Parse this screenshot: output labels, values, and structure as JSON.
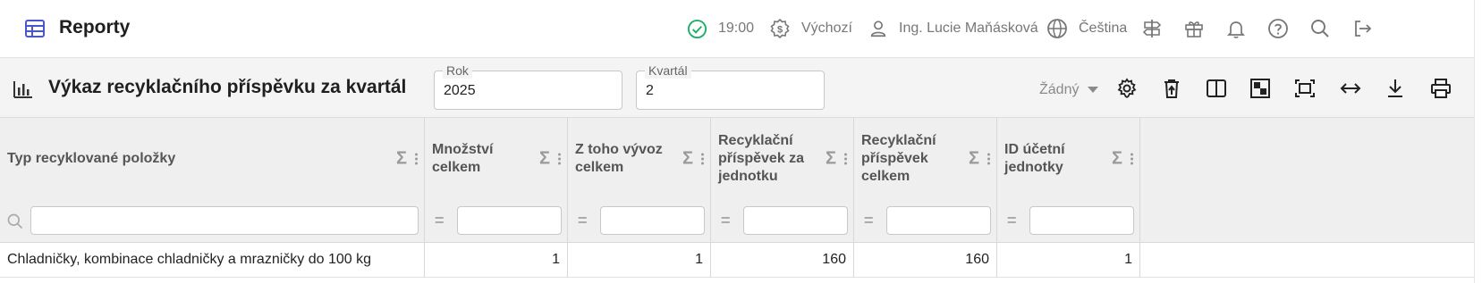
{
  "app": {
    "title": "Reporty",
    "icon": "table-icon"
  },
  "topbar": {
    "time": "19:00",
    "currency": "Výchozí",
    "user": "Ing. Lucie Maňásková",
    "language": "Čeština",
    "icons": [
      "check-circle-icon",
      "currency-icon",
      "user-icon",
      "globe-icon",
      "signpost-icon",
      "gift-icon",
      "bell-icon",
      "help-icon",
      "search-icon",
      "logout-icon"
    ]
  },
  "report": {
    "title": "Výkaz recyklačního příspěvku za kvartál",
    "year_label": "Rok",
    "year_value": "2025",
    "quarter_label": "Kvartál",
    "quarter_value": "2",
    "variant": "Žádný"
  },
  "table": {
    "columns": [
      {
        "label": "Typ recyklované položky"
      },
      {
        "label": "Množství celkem"
      },
      {
        "label": "Z toho vývoz celkem"
      },
      {
        "label": "Recyklační příspěvek za jednotku"
      },
      {
        "label": "Recyklační příspěvek celkem"
      },
      {
        "label": "ID účetní jednotky"
      }
    ],
    "sigma": "Σ",
    "filter_eq": "=",
    "rows": [
      [
        "Chladničky, kombinace chladničky a mrazničky do 100 kg",
        "1",
        "1",
        "160",
        "160",
        "1"
      ]
    ]
  }
}
